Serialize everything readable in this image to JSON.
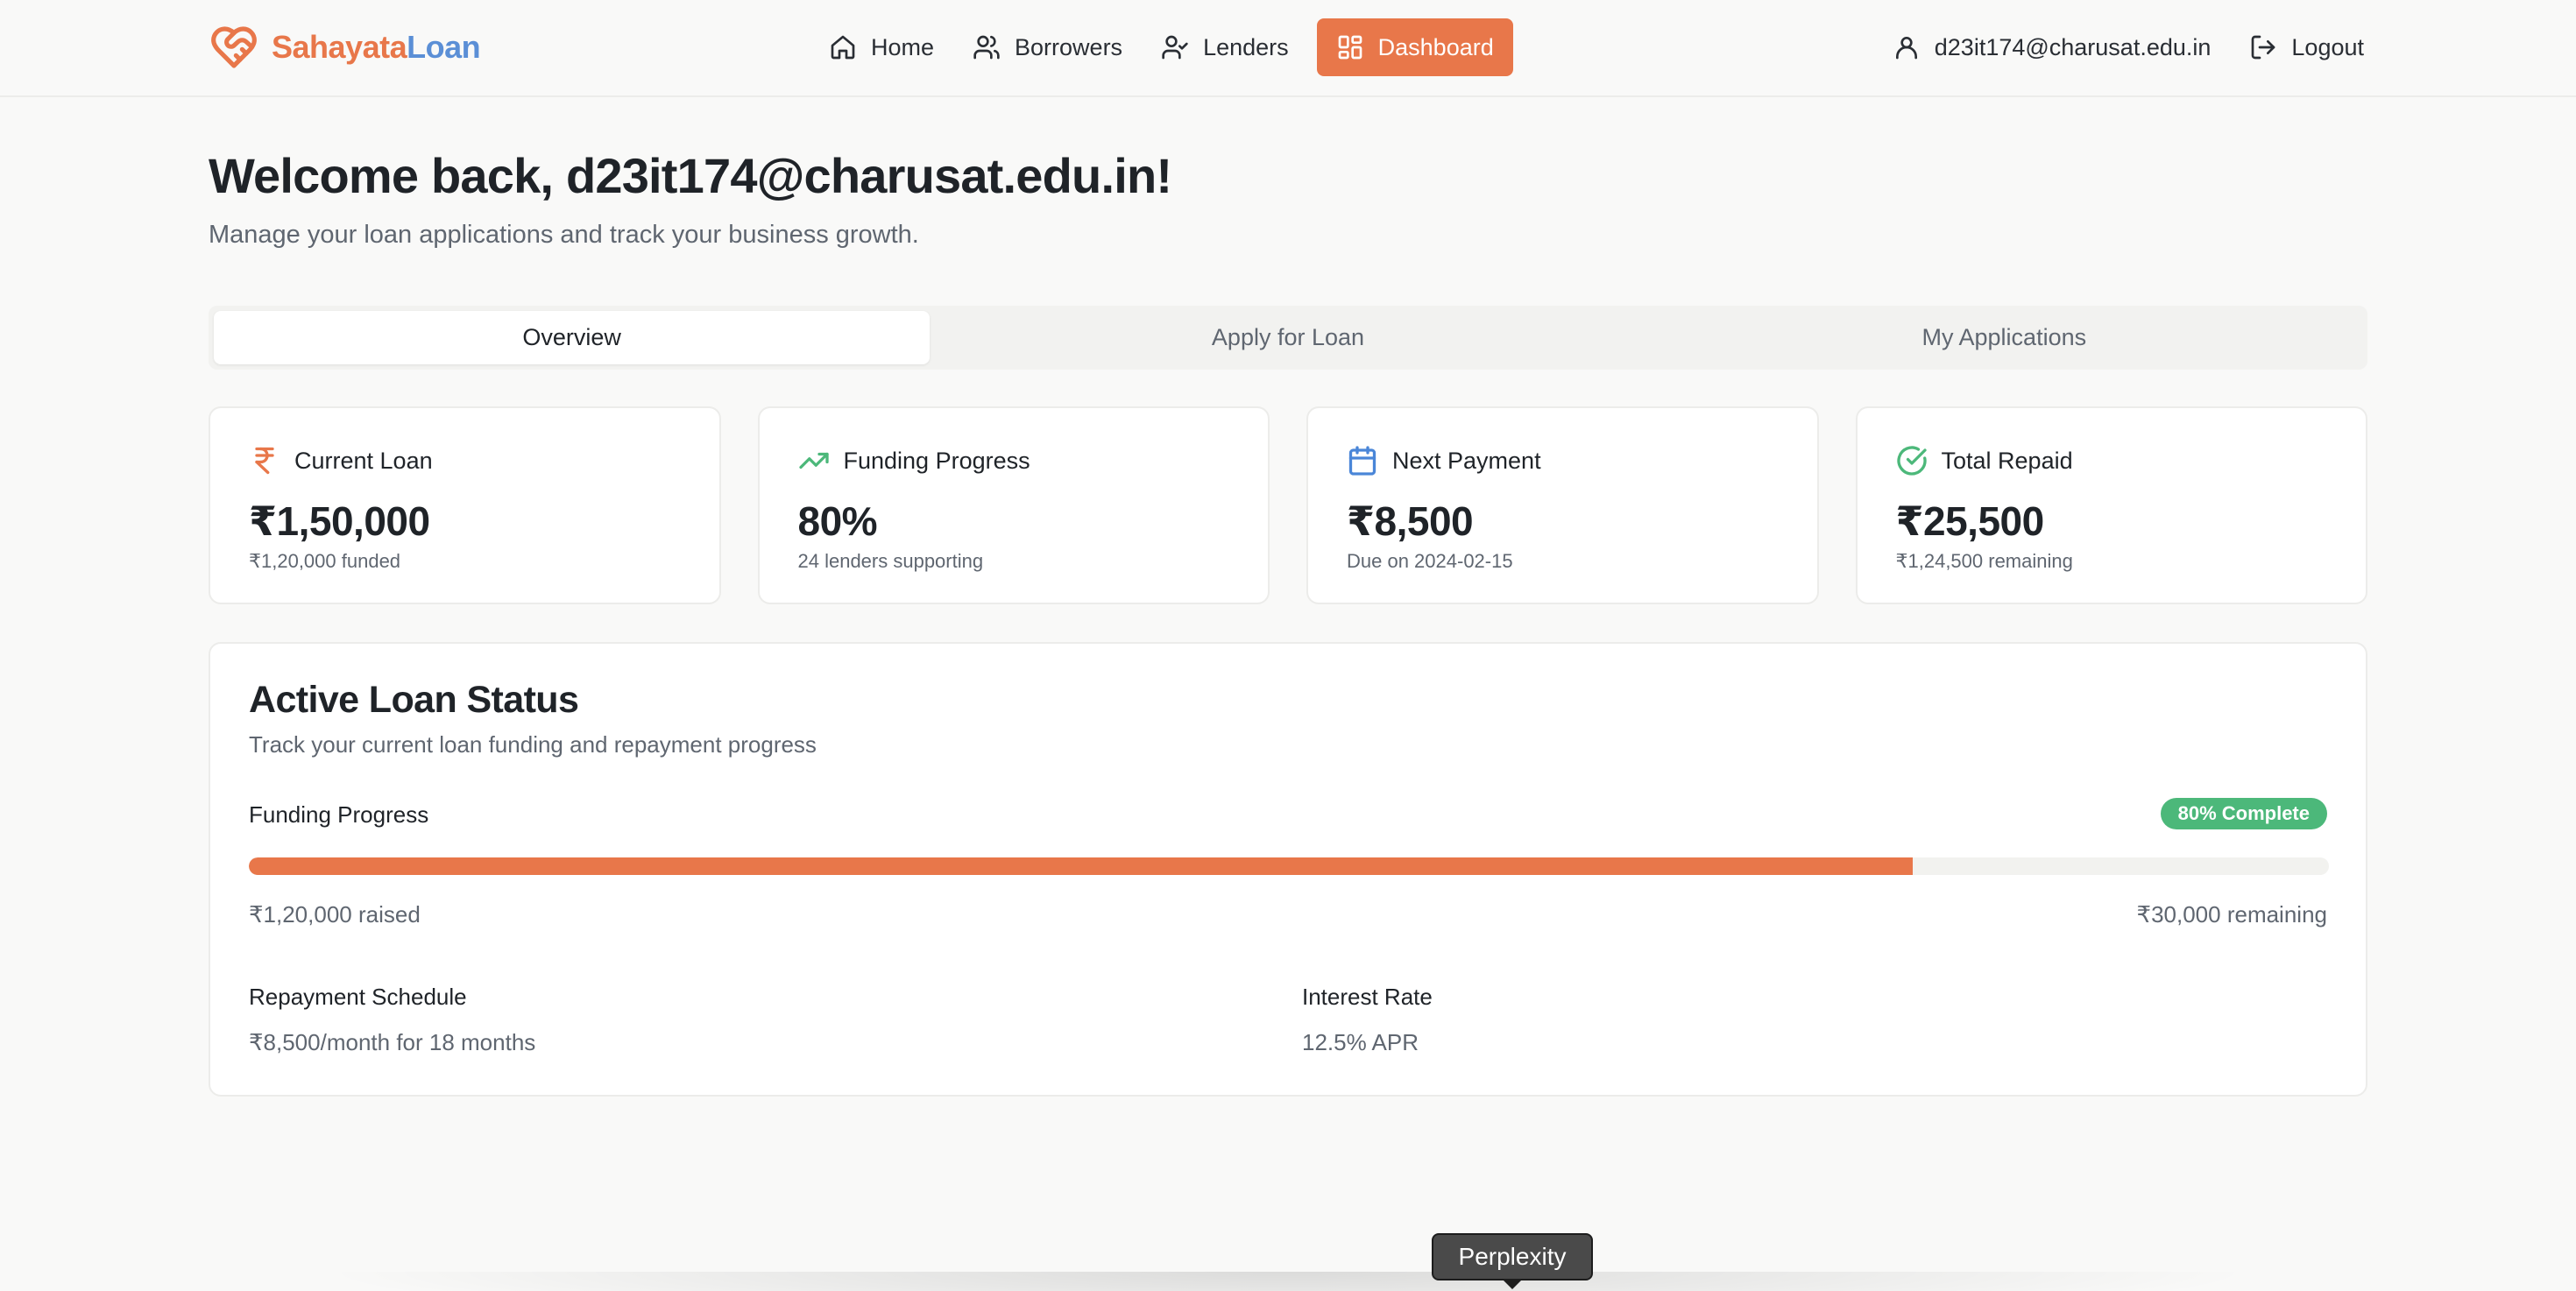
{
  "brand": {
    "part1": "Sahayata",
    "part2": "Loan"
  },
  "nav": {
    "home": "Home",
    "borrowers": "Borrowers",
    "lenders": "Lenders",
    "dashboard": "Dashboard"
  },
  "user": {
    "email": "d23it174@charusat.edu.in",
    "logout": "Logout"
  },
  "header": {
    "welcome": "Welcome back, d23it174@charusat.edu.in!",
    "subtitle": "Manage your loan applications and track your business growth."
  },
  "tabs": [
    "Overview",
    "Apply for Loan",
    "My Applications"
  ],
  "cards": [
    {
      "title": "Current Loan",
      "value": "₹1,50,000",
      "sub": "₹1,20,000 funded",
      "icon": "rupee-icon",
      "color": "#e8774a"
    },
    {
      "title": "Funding Progress",
      "value": "80%",
      "sub": "24 lenders supporting",
      "icon": "trending-up-icon",
      "color": "#4cb87a"
    },
    {
      "title": "Next Payment",
      "value": "₹8,500",
      "sub": "Due on 2024-02-15",
      "icon": "calendar-icon",
      "color": "#4a86d8"
    },
    {
      "title": "Total Repaid",
      "value": "₹25,500",
      "sub": "₹1,24,500 remaining",
      "icon": "check-circle-icon",
      "color": "#4cb87a"
    }
  ],
  "loan_status": {
    "title": "Active Loan Status",
    "subtitle": "Track your current loan funding and repayment progress",
    "funding_label": "Funding Progress",
    "badge": "80% Complete",
    "progress_percent": 80,
    "raised": "₹1,20,000 raised",
    "remaining": "₹30,000 remaining",
    "repayment_label": "Repayment Schedule",
    "repayment_value": "₹8,500/month for 18 months",
    "interest_label": "Interest Rate",
    "interest_value": "12.5% APR"
  },
  "tooltip": "Perplexity",
  "colors": {
    "accent": "#e8774a",
    "brand_blue": "#5b8fd6",
    "success": "#4cb87a"
  }
}
